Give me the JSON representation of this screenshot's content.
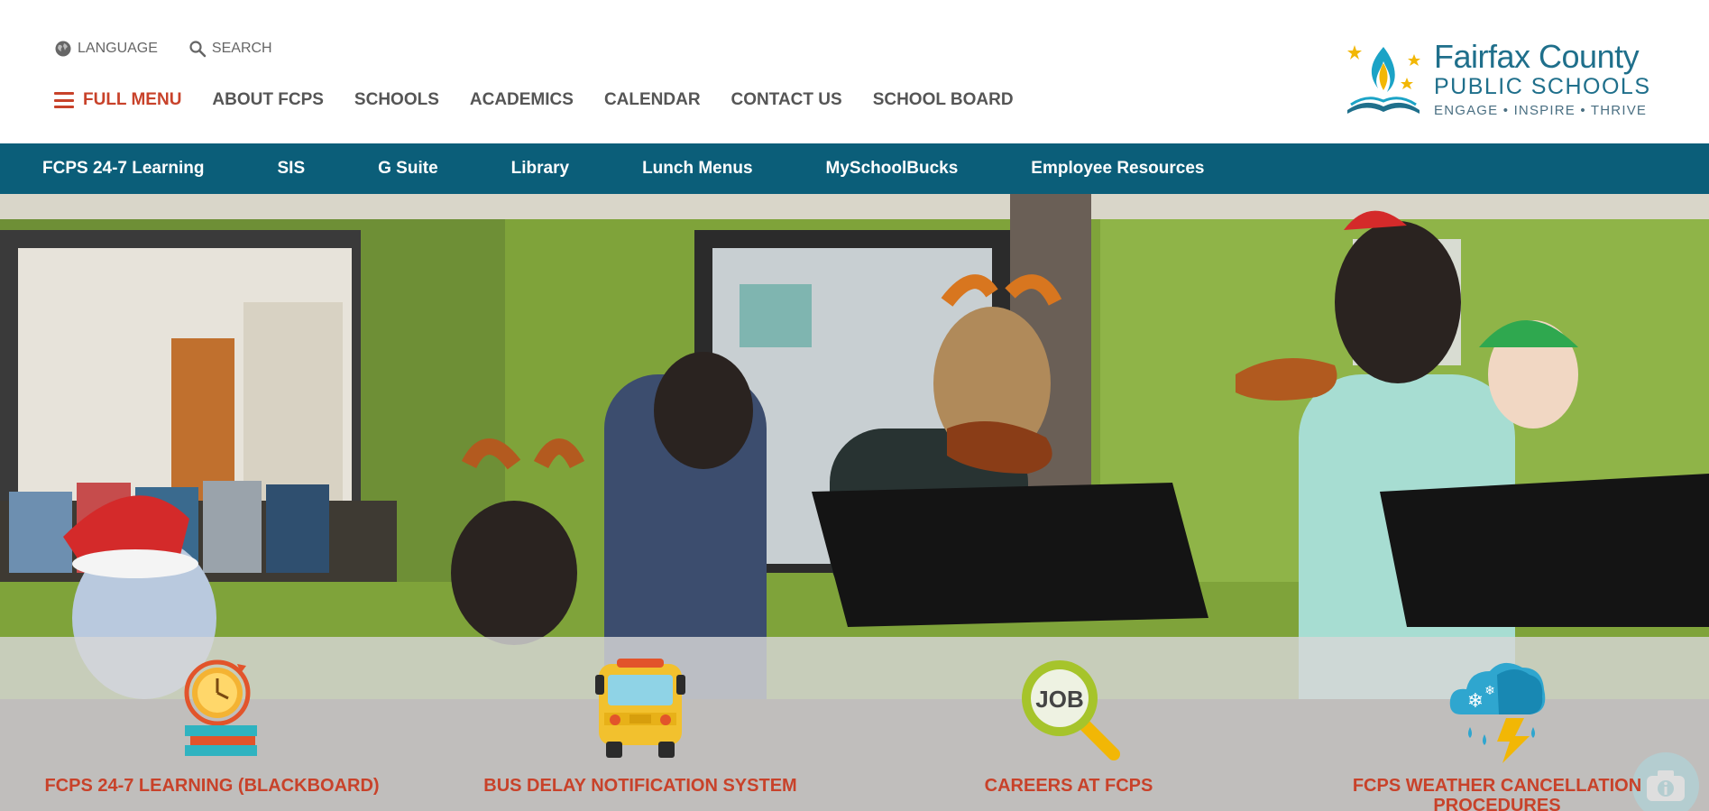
{
  "utility": {
    "language_label": "LANGUAGE",
    "search_label": "SEARCH"
  },
  "nav": {
    "full_menu_label": "FULL MENU",
    "items": [
      "ABOUT FCPS",
      "SCHOOLS",
      "ACADEMICS",
      "CALENDAR",
      "CONTACT US",
      "SCHOOL BOARD"
    ]
  },
  "logo": {
    "line1": "Fairfax County",
    "line2": "PUBLIC SCHOOLS",
    "tagline": "ENGAGE • INSPIRE • THRIVE"
  },
  "quicklinks": [
    "FCPS 24-7 Learning",
    "SIS",
    "G Suite",
    "Library",
    "Lunch Menus",
    "MySchoolBucks",
    "Employee Resources"
  ],
  "features": [
    {
      "label": "FCPS 24-7 LEARNING (BLACKBOARD)",
      "icon": "clock-books-icon"
    },
    {
      "label": "BUS DELAY NOTIFICATION SYSTEM",
      "icon": "school-bus-icon"
    },
    {
      "label": "CAREERS AT FCPS",
      "icon": "job-search-icon"
    },
    {
      "label": "FCPS WEATHER CANCELLATION PROCEDURES",
      "icon": "weather-icon"
    }
  ],
  "colors": {
    "accent_red": "#c8422a",
    "teal_bar": "#0b5e79",
    "logo_blue": "#1f6f8b",
    "info_button": "#17a0b3"
  }
}
